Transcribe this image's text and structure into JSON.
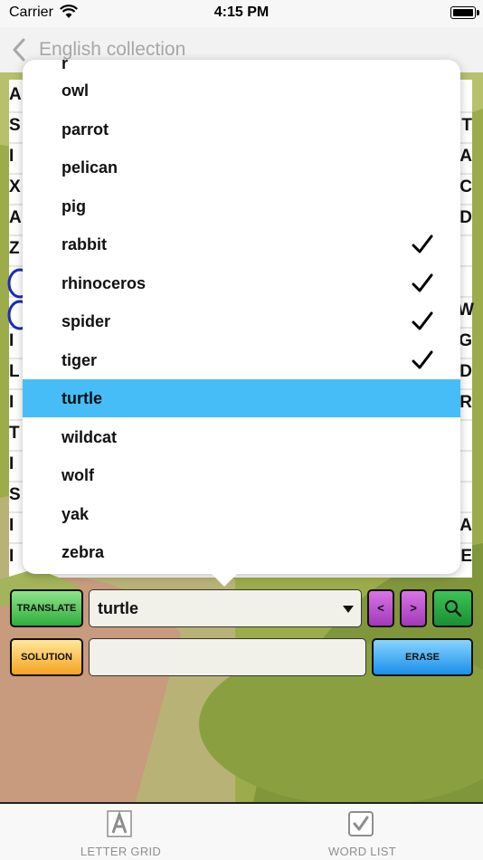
{
  "status_bar": {
    "carrier": "Carrier",
    "time": "4:15 PM"
  },
  "nav": {
    "back_title": "English collection"
  },
  "grid_peek": {
    "left_letters": [
      "A",
      "S",
      "I",
      "X",
      "A",
      "Z",
      "",
      "",
      "I",
      "L",
      "I",
      "T",
      "I",
      "S",
      "I",
      "I"
    ],
    "right_letters": [
      "",
      "T",
      "A",
      "C",
      "D",
      "",
      "",
      "W",
      "G",
      "D",
      "R",
      "",
      "",
      "",
      "A",
      "E"
    ]
  },
  "word_list": {
    "partial_top": "r",
    "items": [
      {
        "label": "owl",
        "checked": false,
        "selected": false
      },
      {
        "label": "parrot",
        "checked": false,
        "selected": false
      },
      {
        "label": "pelican",
        "checked": false,
        "selected": false
      },
      {
        "label": "pig",
        "checked": false,
        "selected": false
      },
      {
        "label": "rabbit",
        "checked": true,
        "selected": false
      },
      {
        "label": "rhinoceros",
        "checked": true,
        "selected": false
      },
      {
        "label": "spider",
        "checked": true,
        "selected": false
      },
      {
        "label": "tiger",
        "checked": true,
        "selected": false
      },
      {
        "label": "turtle",
        "checked": false,
        "selected": true
      },
      {
        "label": "wildcat",
        "checked": false,
        "selected": false
      },
      {
        "label": "wolf",
        "checked": false,
        "selected": false
      },
      {
        "label": "yak",
        "checked": false,
        "selected": false
      },
      {
        "label": "zebra",
        "checked": false,
        "selected": false
      }
    ]
  },
  "controls": {
    "translate_label": "TRANSLATE",
    "selected_word": "turtle",
    "prev_label": "<",
    "next_label": ">",
    "search_icon": "search-icon",
    "solution_label": "SOLUTION",
    "solution_value": "",
    "erase_label": "ERASE"
  },
  "tab_bar": {
    "tabs": [
      {
        "label": "LETTER GRID",
        "icon": "letter-grid-icon"
      },
      {
        "label": "WORD LIST",
        "icon": "checkbox-icon"
      }
    ]
  },
  "colors": {
    "selection": "#46bdf7",
    "translate": "#2fae3c",
    "solution": "#f6a320",
    "erase": "#1a8fea",
    "nav_arrows": "#a33ab8"
  }
}
